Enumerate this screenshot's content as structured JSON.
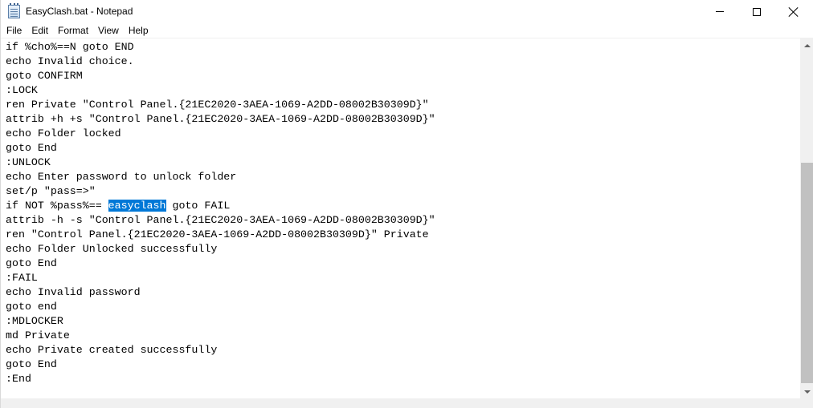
{
  "window": {
    "title": "EasyClash.bat - Notepad"
  },
  "icons": {
    "app": "notepad-icon",
    "minimize": "minimize-icon",
    "maximize": "maximize-icon",
    "close": "close-icon"
  },
  "menu": {
    "file": "File",
    "edit": "Edit",
    "format": "Format",
    "view": "View",
    "help": "Help"
  },
  "editor": {
    "lines": [
      "if %cho%==N goto END",
      "echo Invalid choice.",
      "goto CONFIRM",
      ":LOCK",
      "ren Private \"Control Panel.{21EC2020-3AEA-1069-A2DD-08002B30309D}\"",
      "attrib +h +s \"Control Panel.{21EC2020-3AEA-1069-A2DD-08002B30309D}\"",
      "echo Folder locked",
      "goto End",
      ":UNLOCK",
      "echo Enter password to unlock folder",
      "set/p \"pass=>\"",
      "if NOT %pass%== ",
      "attrib -h -s \"Control Panel.{21EC2020-3AEA-1069-A2DD-08002B30309D}\"",
      "ren \"Control Panel.{21EC2020-3AEA-1069-A2DD-08002B30309D}\" Private",
      "echo Folder Unlocked successfully",
      "goto End",
      ":FAIL",
      "echo Invalid password",
      "goto end",
      ":MDLOCKER",
      "md Private",
      "echo Private created successfully",
      "goto End",
      ":End"
    ],
    "selected_text": "easyclash",
    "after_selection": " goto FAIL",
    "selection_color": "#0078d7"
  }
}
